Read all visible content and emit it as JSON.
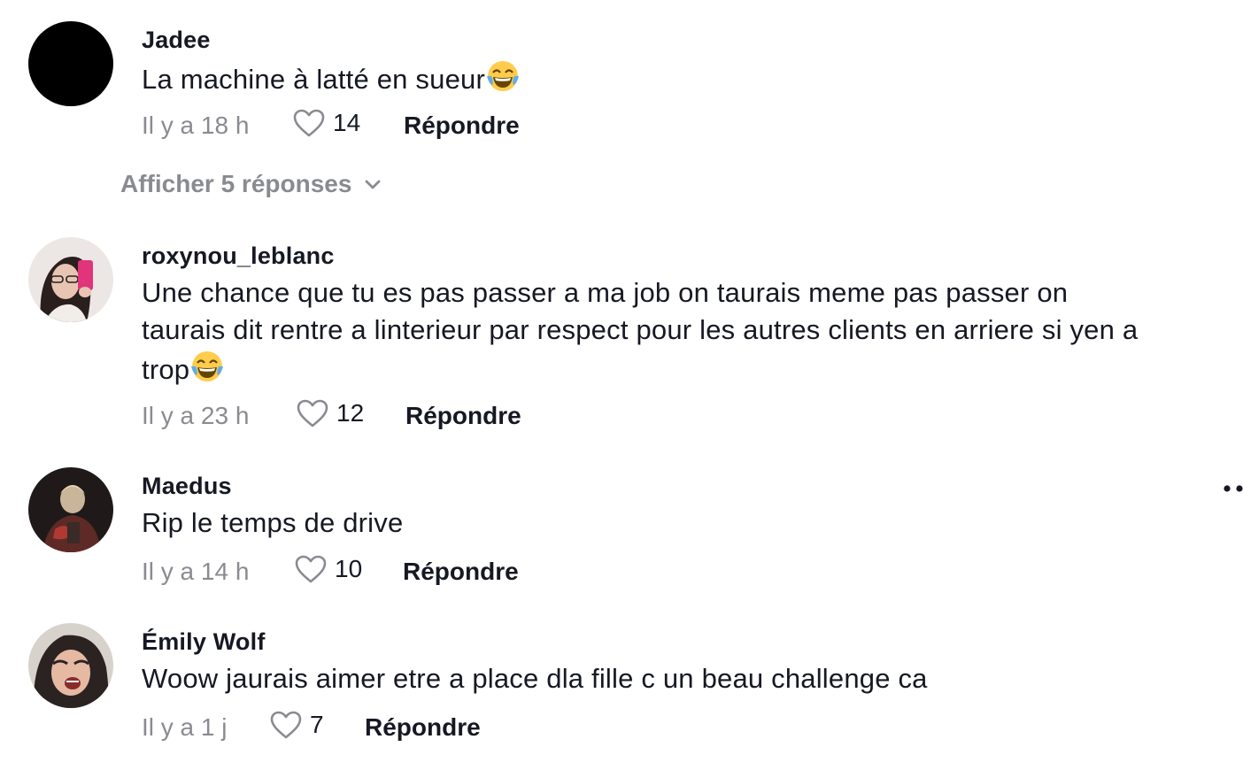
{
  "comments": [
    {
      "username": "Jadee",
      "text": "La machine à latté en sueur",
      "emoji": "😂",
      "time": "Il y a 18 h",
      "likes": "14",
      "reply_label": "Répondre",
      "view_replies": "Afficher 5 réponses"
    },
    {
      "username": "roxynou_leblanc",
      "text_line1": "Une chance que tu es pas passer a ma job on taurais meme pas passer on",
      "text_line2": "taurais dit rentre a linterieur par respect pour les autres clients en arriere si yen a",
      "text_line3": "trop",
      "emoji": "😂",
      "time": "Il y a 23 h",
      "likes": "12",
      "reply_label": "Répondre"
    },
    {
      "username": "Maedus",
      "text": "Rip le temps de drive",
      "time": "Il y a 14 h",
      "likes": "10",
      "reply_label": "Répondre"
    },
    {
      "username": "Émily Wolf",
      "text": "Woow jaurais aimer etre a place dla fille c un beau challenge ca",
      "time": "Il y a 1 j",
      "likes": "7",
      "reply_label": "Répondre"
    }
  ],
  "icons": {
    "like": "heart-outline-icon",
    "expand": "chevron-down-icon",
    "more": "more-dots-icon"
  },
  "colors": {
    "text_primary": "#161823",
    "text_secondary": "#8a8b91"
  }
}
